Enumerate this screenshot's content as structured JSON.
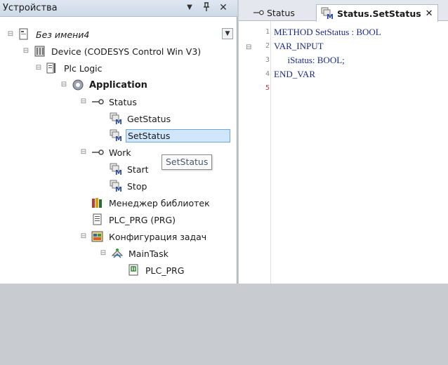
{
  "devices_panel": {
    "title": "Устройства",
    "menu_glyph": "▼",
    "pin_glyph": "ᵽ",
    "close_glyph": "✕",
    "dropdown_glyph": "▼"
  },
  "tree": {
    "project": "Без имени4",
    "device": "Device (CODESYS Control Win V3)",
    "plc_logic": "Plc Logic",
    "application": "Application",
    "status": "Status",
    "get_status": "GetStatus",
    "set_status": "SetStatus",
    "work": "Work",
    "start": "Start",
    "stop": "Stop",
    "library_manager": "Менеджер библиотек",
    "plc_prg": "PLC_PRG (PRG)",
    "task_config": "Конфигурация задач",
    "main_task": "MainTask",
    "task_plc_prg": "PLC_PRG"
  },
  "tooltip": "SetStatus",
  "editor": {
    "tab_status": "Status",
    "tab_set_status": "Status.SetStatus",
    "tab_close": "✕",
    "line_numbers": [
      "1",
      "2",
      "3",
      "4",
      "5"
    ],
    "code": [
      "METHOD SetStatus : BOOL",
      "VAR_INPUT",
      "      iStatus: BOOL;",
      "END_VAR",
      ""
    ]
  },
  "colors": {
    "selection": "#cfe6fb",
    "keyword": "#1a2a8a",
    "active_line_number": "#d04040"
  }
}
